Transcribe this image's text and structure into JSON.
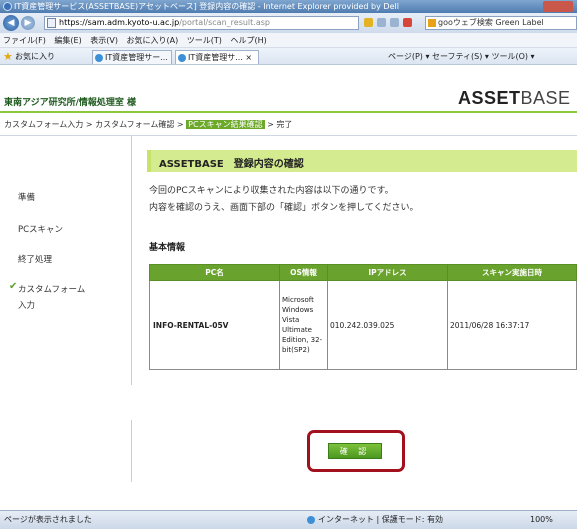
{
  "window": {
    "title": "IT資産管理サービス(ASSETBASE)アセットベース] 登録内容の確認 - Internet Explorer provided by Dell"
  },
  "addressbar": {
    "url_domain": "https://sam.adm.kyoto-u.ac.jp",
    "url_path": "/portal/scan_result.asp",
    "search_text": "gooウェブ検索 Green Label"
  },
  "menu": {
    "items": [
      "ファイル(F)",
      "編集(E)",
      "表示(V)",
      "お気に入り(A)",
      "ツール(T)",
      "ヘルプ(H)"
    ]
  },
  "favorites": {
    "label": "お気に入り",
    "tabs": [
      "IT資産管理サー...",
      "IT資産管理サ... ×"
    ],
    "tools": "ページ(P) ▾  セーフティ(S) ▾  ツール(O) ▾"
  },
  "header": {
    "org": "東南アジア研究所/情報処理室 様",
    "logo_bold": "ASSET",
    "logo_light": "BASE"
  },
  "breadcrumb": {
    "step1": "カスタムフォーム入力",
    "step2": "カスタムフォーム確認",
    "current": "PCスキャン結果確認",
    "step4": "完了",
    "sep": " > "
  },
  "sidebar": {
    "items": [
      "準備",
      "PCスキャン",
      "終了処理",
      "カスタムフォーム",
      "入力"
    ]
  },
  "main": {
    "title": "ASSETBASE　登録内容の確認",
    "msg1": "今回のPCスキャンにより収集された内容は以下の通りです。",
    "msg2": "内容を確認のうえ、画面下部の「確認」ボタンを押してください。",
    "section": "基本情報",
    "table": {
      "headers": [
        "PC名",
        "OS情報",
        "IPアドレス",
        "スキャン実施日時"
      ],
      "row": {
        "pc": "INFO-RENTAL-05V",
        "os": "Microsoft Windows Vista Ultimate Edition, 32-bit(SP2)",
        "ip": "010.242.039.025",
        "scan": "2011/06/28 16:37:17"
      }
    }
  },
  "confirm_label": "確 認",
  "status": {
    "left": "ページが表示されました",
    "zone": "インターネット | 保護モード: 有効",
    "zoom": "100%"
  }
}
